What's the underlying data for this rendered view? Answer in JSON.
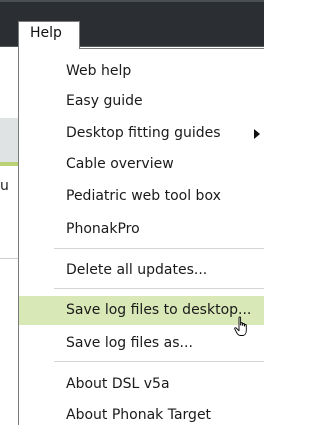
{
  "menubar": {
    "help_label": "Help"
  },
  "background": {
    "partial_text": "u"
  },
  "menu": {
    "items": [
      {
        "label": "Web help"
      },
      {
        "label": "Easy guide"
      },
      {
        "label": "Desktop fitting guides",
        "submenu_icon": "chevron-right-icon"
      },
      {
        "label": "Cable overview"
      },
      {
        "label": "Pediatric web tool box"
      },
      {
        "label": "PhonakPro"
      },
      {
        "label": "Delete all updates..."
      },
      {
        "label": "Save log files to desktop...",
        "state": "hovered"
      },
      {
        "label": "Save log files as..."
      },
      {
        "label": "About DSL v5a"
      },
      {
        "label": "About Phonak Target"
      }
    ]
  },
  "colors": {
    "menubar_bg": "#2b2f33",
    "hover_highlight": "#d9e8b7",
    "accent_green": "#b9d275"
  },
  "cursor": {
    "icon": "hand-pointer-icon"
  }
}
